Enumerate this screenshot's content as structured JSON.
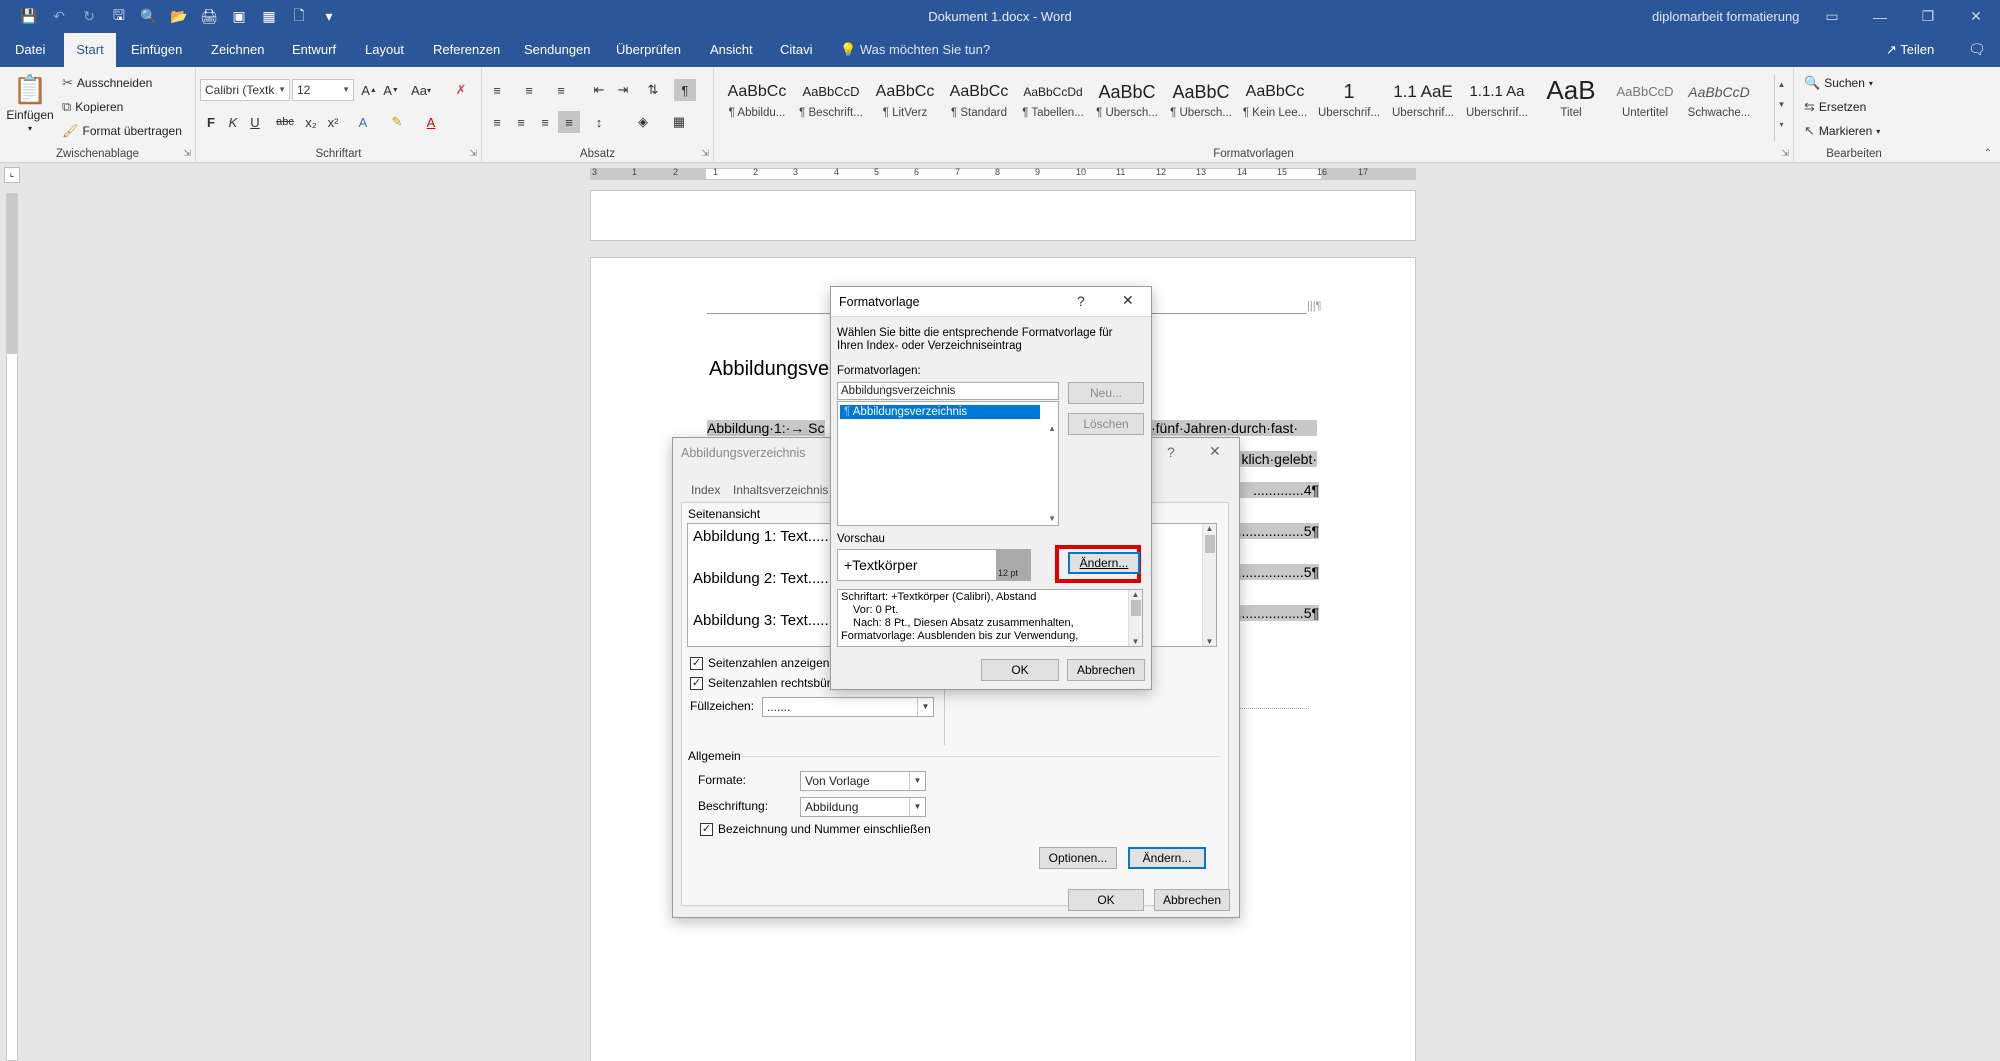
{
  "window": {
    "title": "Dokument 1.docx - Word",
    "account": "diplomarbeit formatierung"
  },
  "qat": {
    "icons": [
      "save-icon",
      "undo-icon",
      "redo-icon",
      "save-as-icon",
      "print-preview-icon",
      "open-icon",
      "print-icon",
      "page-view-icon",
      "table-icon",
      "new-document-icon",
      "customize-icon"
    ]
  },
  "tabs": [
    {
      "label": "Datei"
    },
    {
      "label": "Start"
    },
    {
      "label": "Einfügen"
    },
    {
      "label": "Zeichnen"
    },
    {
      "label": "Entwurf"
    },
    {
      "label": "Layout"
    },
    {
      "label": "Referenzen"
    },
    {
      "label": "Sendungen"
    },
    {
      "label": "Überprüfen"
    },
    {
      "label": "Ansicht"
    },
    {
      "label": "Citavi"
    }
  ],
  "tell_me": "Was möchten Sie tun?",
  "share": "Teilen",
  "ribbon": {
    "clipboard": {
      "label": "Zwischenablage",
      "paste": "Einfügen",
      "cut": "Ausschneiden",
      "copy": "Kopieren",
      "format_painter": "Format übertragen"
    },
    "font": {
      "label": "Schriftart",
      "name": "Calibri (Textk",
      "size": "12",
      "bold": "F",
      "italic": "K",
      "underline": "U",
      "strike": "abc",
      "sub": "x₂",
      "sup": "x²",
      "case": "Aa"
    },
    "paragraph": {
      "label": "Absatz"
    },
    "styles": {
      "label": "Formatvorlagen",
      "items": [
        {
          "preview": "AaBbCc",
          "name": "¶ Abbildu..."
        },
        {
          "preview": "AaBbCcD",
          "name": "¶ Beschrift..."
        },
        {
          "preview": "AaBbCc",
          "name": "¶ LitVerz"
        },
        {
          "preview": "AaBbCc",
          "name": "¶ Standard"
        },
        {
          "preview": "AaBbCcDd",
          "name": "¶ Tabellen..."
        },
        {
          "preview": "AaBbC",
          "name": "¶ Übersch..."
        },
        {
          "preview": "AaBbC",
          "name": "¶ Übersch..."
        },
        {
          "preview": "AaBbCc",
          "name": "¶ Kein Lee..."
        },
        {
          "preview": "1",
          "name": "Überschrif..."
        },
        {
          "preview": "1.1 AaE",
          "name": "Überschrif..."
        },
        {
          "preview": "1.1.1 Aa",
          "name": "Überschrif..."
        },
        {
          "preview": "AaB",
          "name": "Titel"
        },
        {
          "preview": "AaBbCcD",
          "name": "Untertitel"
        },
        {
          "preview": "AaBbCcD",
          "name": "Schwache..."
        }
      ]
    },
    "editing": {
      "label": "Bearbeiten",
      "find": "Suchen",
      "replace": "Ersetzen",
      "select": "Markieren"
    }
  },
  "ruler": {
    "numbers": [
      "3",
      "1",
      "2",
      "1",
      "2",
      "3",
      "4",
      "5",
      "6",
      "7",
      "8",
      "9",
      "10",
      "11",
      "12",
      "13",
      "14",
      "15",
      "16",
      "17"
    ]
  },
  "document": {
    "heading": "Abbildungsver",
    "line1_left": "Abbildung·1:·→ Sc",
    "line1_right": "·fünf·Jahren·durch·fast·",
    "line2_right": "klich·gelebt·",
    "entries_right": [
      "4¶",
      "5¶",
      "5¶",
      "5¶"
    ],
    "header_mark": "|||¶"
  },
  "dlg_toc": {
    "title": "Abbildungsverzeichnis",
    "tabs": [
      "Index",
      "Inhaltsverzeichnis"
    ],
    "preview_label": "Seitenansicht",
    "preview_lines": [
      "Abbildung 1: Text.....",
      "Abbildung 2: Text.....",
      "Abbildung 3: Text....."
    ],
    "show_page_numbers": "Seitenzahlen anzeigen",
    "right_align": "Seitenzahlen rechtsbün",
    "fill_label": "Füllzeichen:",
    "fill_value": ".......",
    "general": "Allgemein",
    "formats_label": "Formate:",
    "formats_value": "Von Vorlage",
    "caption_label": "Beschriftung:",
    "caption_value": "Abbildung",
    "include_label": "Bezeichnung und Nummer einschließen",
    "options": "Optionen...",
    "modify": "Ändern...",
    "ok": "OK",
    "cancel": "Abbrechen"
  },
  "dlg_style": {
    "title": "Formatvorlage",
    "help": "?",
    "instructions": "Wählen Sie bitte die entsprechende Formatvorlage für Ihren Index- oder Verzeichniseintrag",
    "styles_label": "Formatvorlagen:",
    "styles_input": "Abbildungsverzeichnis",
    "list_item": "Abbildungsverzeichnis",
    "new": "Neu...",
    "delete": "Löschen",
    "preview_label": "Vorschau",
    "preview_text": "+Textkörper",
    "preview_size": "12 pt",
    "modify": "Ändern...",
    "desc_lines": [
      "Schriftart: +Textkörper (Calibri), Abstand",
      "Vor:  0 Pt.",
      "Nach:  8 Pt., Diesen Absatz zusammenhalten,",
      "Formatvorlage: Ausblenden bis zur Verwendung,"
    ],
    "ok": "OK",
    "cancel": "Abbrechen"
  },
  "colors": {
    "word_blue": "#2b579a",
    "highlight_red": "#e00000",
    "selection_blue": "#0078d7"
  }
}
